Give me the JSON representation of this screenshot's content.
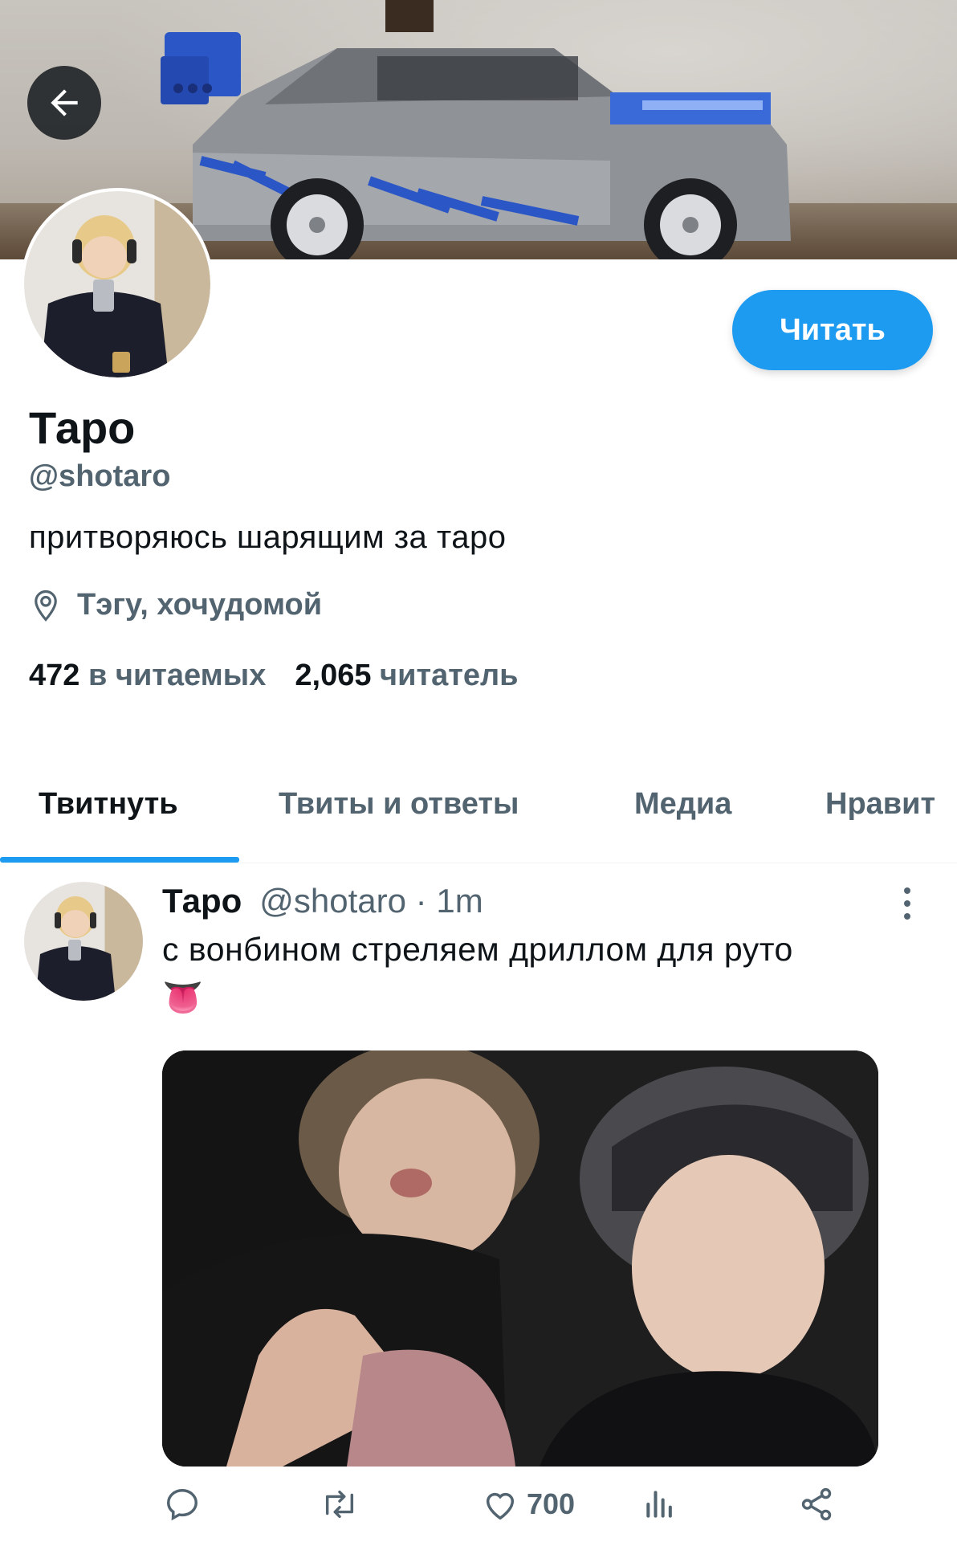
{
  "header": {
    "back_icon": "arrow-left-icon",
    "banner_description_icon": "banner-image"
  },
  "profile": {
    "name": "Таро",
    "handle": "@shotaro",
    "bio": "притворяюсь шарящим за таро",
    "location": "Тэгу, хочудомой",
    "following_count": "472",
    "following_label": "в читаемых",
    "followers_count": "2,065",
    "followers_label": "читатель",
    "follow_label": "Читать"
  },
  "tabs": [
    {
      "label": "Твитнуть",
      "active": true
    },
    {
      "label": "Твиты и ответы",
      "active": false
    },
    {
      "label": "Медиа",
      "active": false
    },
    {
      "label": "Нравит",
      "active": false
    }
  ],
  "tweet": {
    "name": "Таро",
    "meta": "@shotaro · 1m",
    "text": "с вонбином стреляем дриллом для руто",
    "emoji": "👅",
    "like_count": "700"
  },
  "colors": {
    "accent": "#1d9bf0",
    "secondary_text": "#536471",
    "primary_text": "#0f1419"
  }
}
